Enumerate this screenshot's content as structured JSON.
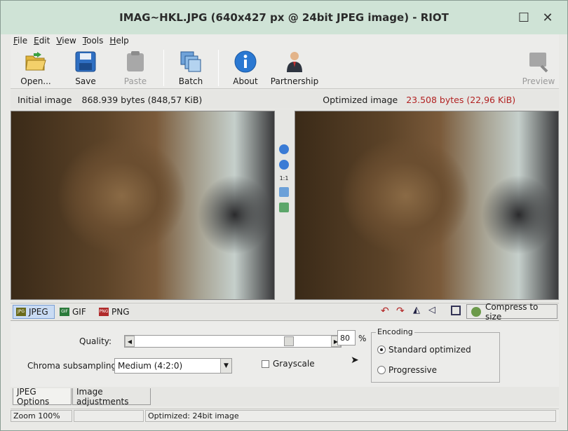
{
  "window": {
    "title": "IMAG~HKL.JPG (640x427 px @ 24bit JPEG image) - RIOT"
  },
  "menu": [
    {
      "pre": "",
      "u": "F",
      "post": "ile"
    },
    {
      "pre": "",
      "u": "E",
      "post": "dit"
    },
    {
      "pre": "",
      "u": "V",
      "post": "iew"
    },
    {
      "pre": "",
      "u": "T",
      "post": "ools"
    },
    {
      "pre": "",
      "u": "H",
      "post": "elp"
    }
  ],
  "toolbar": {
    "open": "Open...",
    "save": "Save",
    "paste": "Paste",
    "batch": "Batch",
    "about": "About",
    "partnership": "Partnership",
    "preview": "Preview"
  },
  "info": {
    "initial_label": "Initial image",
    "initial_size": "868.939 bytes (848,57 KiB)",
    "optimized_label": "Optimized image",
    "optimized_size": "23.508 bytes (22,96 KiB)",
    "optimized_color": "#b22222"
  },
  "midtools": {
    "ratio_label": "1:1"
  },
  "format_tabs": {
    "jpeg": "JPEG",
    "gif": "GIF",
    "png": "PNG",
    "jpeg_badge": "JPG",
    "gif_badge": "GIF",
    "png_badge": "PNG"
  },
  "compress_button": "Compress to size",
  "jpeg_options": {
    "quality_label": "Quality:",
    "quality_value": "80",
    "quality_unit": "%",
    "chroma_label": "Chroma subsampling:",
    "chroma_value": "Medium (4:2:0)",
    "grayscale_label": "Grayscale",
    "encoding_label": "Encoding",
    "standard_label": "Standard optimized",
    "progressive_label": "Progressive"
  },
  "bottom_tabs": {
    "jpeg_options": "JPEG Options",
    "image_adjustments": "Image adjustments"
  },
  "status": {
    "zoom": "Zoom 100%",
    "middle": "",
    "optimized": "Optimized: 24bit  image"
  },
  "colors": {
    "titlebar": "#cfe3d6",
    "active_tab": "#c9dbf3"
  }
}
